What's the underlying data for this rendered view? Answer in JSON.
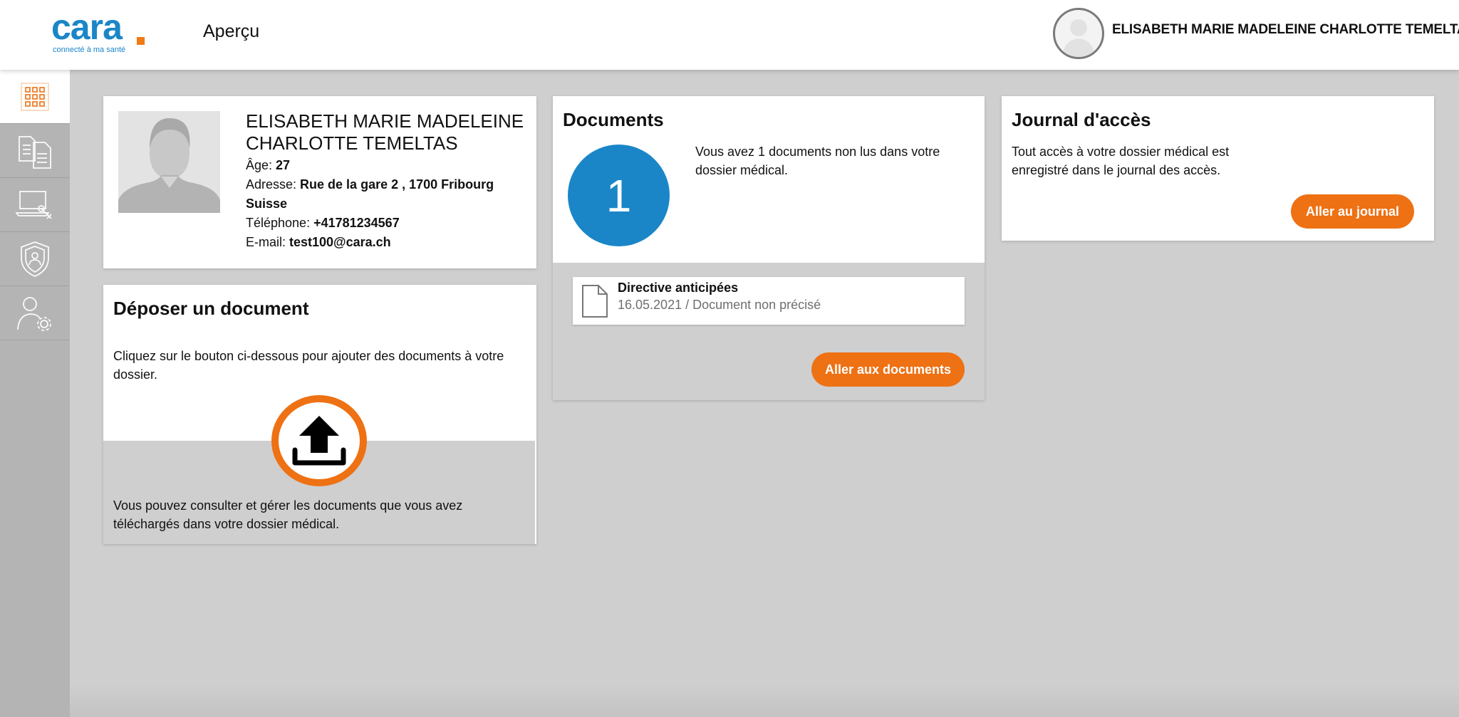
{
  "header": {
    "logo_text": "cara",
    "logo_tagline": "connecté à ma santé",
    "page_title": "Aperçu",
    "user_name": "ELISABETH MARIE MADELEINE CHARLOTTE TEMELTAS"
  },
  "sidebar": {
    "items": [
      {
        "name": "overview",
        "icon": "grid-icon",
        "active": true
      },
      {
        "name": "documents",
        "icon": "documents-icon",
        "active": false
      },
      {
        "name": "services",
        "icon": "laptop-tools-icon",
        "active": false
      },
      {
        "name": "access-rights",
        "icon": "shield-user-icon",
        "active": false
      },
      {
        "name": "settings",
        "icon": "user-gear-icon",
        "active": false
      }
    ]
  },
  "profile": {
    "name": "ELISABETH MARIE MADELEINE CHARLOTTE TEMELTAS",
    "age_label": "Âge: ",
    "age": "27",
    "address_label": "Adresse: ",
    "address": "Rue de la gare 2 , 1700 Fribourg Suisse",
    "phone_label": "Téléphone: ",
    "phone": "+41781234567",
    "email_label": "E-mail: ",
    "email": "test100@cara.ch"
  },
  "documents": {
    "title": "Documents",
    "unread_count": "1",
    "message": "Vous avez 1 documents non lus dans votre dossier médical.",
    "items": [
      {
        "title": "Directive anticipées",
        "subtitle": "16.05.2021 / Document non précisé"
      }
    ],
    "button_label": "Aller aux documents"
  },
  "journal": {
    "title": "Journal d'accès",
    "text": "Tout accès à votre dossier médical est enregistré dans le journal des accès.",
    "button_label": "Aller au journal"
  },
  "upload": {
    "title": "Déposer un document",
    "text_top": "Cliquez sur le bouton ci-dessous pour ajouter des documents à votre dossier.",
    "text_bottom": "Vous pouvez consulter et gérer les documents que vous avez téléchargés dans votre dossier médical."
  },
  "colors": {
    "brand_blue": "#1a86c8",
    "accent_orange": "#ee7114",
    "background": "#cfcfcf",
    "sidebar": "#b4b4b4"
  }
}
